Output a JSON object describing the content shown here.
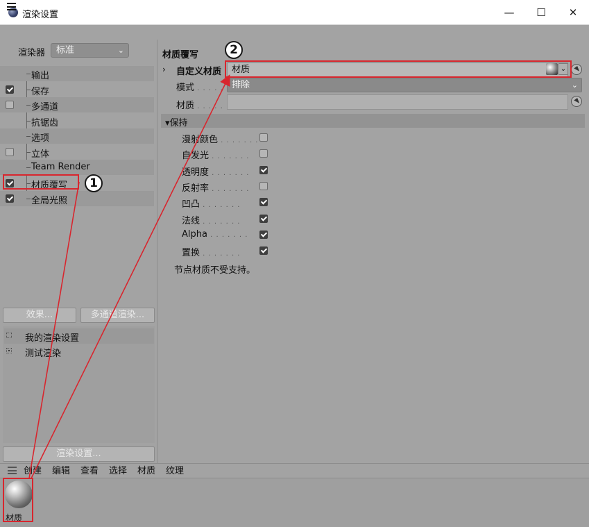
{
  "window": {
    "title": "渲染设置",
    "minimize": "—",
    "maximize": "☐",
    "close": "✕"
  },
  "left": {
    "renderer_label": "渲染器",
    "renderer_value": "标准",
    "items": [
      {
        "label": "输出",
        "checkbox": false,
        "checked": false
      },
      {
        "label": "保存",
        "checkbox": true,
        "checked": true
      },
      {
        "label": "多通道",
        "checkbox": true,
        "checked": false
      },
      {
        "label": "抗锯齿",
        "checkbox": false,
        "checked": false
      },
      {
        "label": "选项",
        "checkbox": false,
        "checked": false
      },
      {
        "label": "立体",
        "checkbox": true,
        "checked": false
      },
      {
        "label": "Team Render",
        "checkbox": false,
        "checked": false
      },
      {
        "label": "材质覆写",
        "checkbox": true,
        "checked": true
      },
      {
        "label": "全局光照",
        "checkbox": true,
        "checked": true
      }
    ],
    "effects_button": "效果...",
    "multipass_button": "多通道渲染...",
    "presets": [
      "我的渲染设置",
      "测试渲染"
    ],
    "render_settings_button": "渲染设置..."
  },
  "right": {
    "section_title": "材质覆写",
    "custom_label": "自定义材质",
    "custom_value": "材质",
    "mode_label": "模式",
    "mode_value": "排除",
    "material_label": "材质",
    "dots": ". . . . . . .",
    "keep_header": "▾保持",
    "keep_items": [
      {
        "label": "漫射颜色",
        "checked": false
      },
      {
        "label": "自发光",
        "checked": false
      },
      {
        "label": "透明度",
        "checked": true
      },
      {
        "label": "反射率",
        "checked": false
      },
      {
        "label": "凹凸",
        "checked": true
      },
      {
        "label": "法线",
        "checked": true
      },
      {
        "label": "Alpha",
        "checked": true
      },
      {
        "label": "置换",
        "checked": true
      }
    ],
    "note": "节点材质不受支持。"
  },
  "bottom": {
    "menus": [
      "创建",
      "编辑",
      "查看",
      "选择",
      "材质",
      "纹理"
    ],
    "material_name": "材质"
  },
  "annotations": {
    "badge1": "1",
    "badge2": "2",
    "color": "#d8262e"
  }
}
